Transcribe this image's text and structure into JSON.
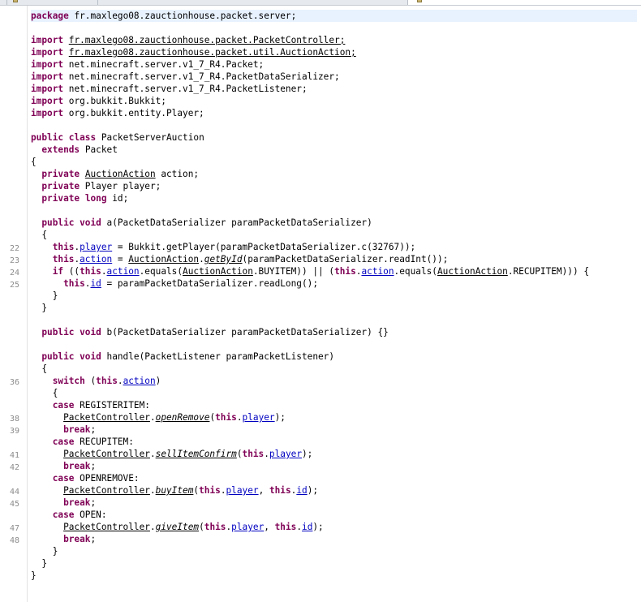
{
  "package_line": "fr.maxlego08.zauctionhouse.packet.server;",
  "imports": [
    {
      "path": "fr.maxlego08.zauctionhouse.packet.PacketController;"
    },
    {
      "path": "fr.maxlego08.zauctionhouse.packet.util.AuctionAction;"
    },
    {
      "path": "net.minecraft.server.v1_7_R4.Packet;"
    },
    {
      "path": "net.minecraft.server.v1_7_R4.PacketDataSerializer;"
    },
    {
      "path": "net.minecraft.server.v1_7_R4.PacketListener;"
    },
    {
      "path": "org.bukkit.Bukkit;"
    },
    {
      "path": "org.bukkit.entity.Player;"
    }
  ],
  "class_name": "PacketServerAuction",
  "superclass": "Packet",
  "line_numbers": [
    "22",
    "23",
    "24",
    "25",
    "36",
    "38",
    "39",
    "41",
    "42",
    "44",
    "45",
    "47",
    "48"
  ],
  "keywords": {
    "package": "package",
    "import": "import",
    "public": "public",
    "class": "class",
    "extends": "extends",
    "private": "private",
    "long": "long",
    "void": "void",
    "this": "this",
    "if": "if",
    "switch": "switch",
    "case": "case",
    "break": "break"
  },
  "code": {
    "f1_type": "AuctionAction",
    "f1_name": " action;",
    "f2": " Player player;",
    "f3_name": " id;",
    "m_a_sig": " a(PacketDataSerializer paramPacketDataSerializer)",
    "l22_rest": " = Bukkit.getPlayer(paramPacketDataSerializer.c(32767));",
    "l23_eq": " = ",
    "l23_cls": "AuctionAction",
    "l23_mid": ".",
    "l23_m": "getById",
    "l23_rest": "(paramPacketDataSerializer.readInt());",
    "l24_a": " ((",
    "l24_b": ".equals(",
    "l24_c": ".BUYITEM)) || (",
    "l24_d": ".equals(",
    "l24_e": ".RECUPITEM))) {",
    "l25_rest": " = paramPacketDataSerializer.readLong();",
    "m_b_sig": " b(PacketDataSerializer paramPacketDataSerializer) {}",
    "m_h_sig": " handle(PacketListener paramPacketListener)",
    "sw_a": " (",
    "sw_b": ")",
    "case1": " REGISTERITEM:",
    "case2": " RECUPITEM:",
    "case3": " OPENREMOVE:",
    "case4": " OPEN:",
    "ctrl": "PacketController",
    "m_openRemove": "openRemove",
    "m_sell": "sellItemConfirm",
    "m_buy": "buyItem",
    "m_give": "giveItem",
    "fld_player": "player",
    "fld_action": "action",
    "fld_id": "id",
    "dot": ".",
    "open_paren": "(",
    "close_stmt": ");",
    "comma_sp": ", ",
    "semi": ";"
  }
}
